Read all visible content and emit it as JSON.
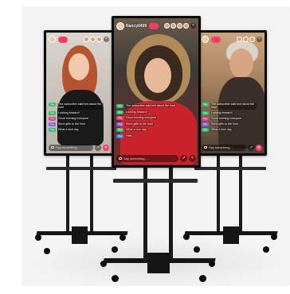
{
  "product": {
    "units": [
      {
        "id": "left",
        "streamer_name": "",
        "chat": [
          {
            "tag": "Tag",
            "text": "The subscriber said text about the host"
          },
          {
            "tag": "Tag",
            "text": "Looking forward!"
          },
          {
            "tag": "Tag",
            "text": "Good evening everyone"
          },
          {
            "tag": "Tag",
            "text": "Send gifts to the host"
          },
          {
            "tag": "Tag",
            "text": "What a nice day"
          },
          {
            "tag": "Tag",
            "text": "Hello"
          }
        ],
        "input_placeholder": "Say something..."
      },
      {
        "id": "center",
        "streamer_name": "Nancy0409",
        "chat": [
          {
            "tag": "Tag",
            "text": "The subscriber said text about the host"
          },
          {
            "tag": "Tag",
            "text": "Looking forward!"
          },
          {
            "tag": "Tag",
            "text": "Good evening everyone"
          },
          {
            "tag": "Tag",
            "text": "Send gifts to the host"
          },
          {
            "tag": "Tag",
            "text": "What a nice day"
          },
          {
            "tag": "Tag",
            "text": "Hello"
          }
        ],
        "input_placeholder": "Say something..."
      },
      {
        "id": "right",
        "streamer_name": "",
        "chat": [
          {
            "tag": "Tag",
            "text": "The subscriber said text about the host"
          },
          {
            "tag": "Tag",
            "text": "Looking forward!"
          },
          {
            "tag": "Tag",
            "text": "Good evening everyone"
          },
          {
            "tag": "Tag",
            "text": "Send gifts to the host"
          },
          {
            "tag": "Tag",
            "text": "What a nice day"
          },
          {
            "tag": "Tag",
            "text": "Hello"
          }
        ],
        "input_placeholder": "Say something..."
      }
    ],
    "colors": {
      "stand": "#1b1b1b",
      "follow_accent": "#ff3b6b",
      "tag_colors": [
        "#2fbf71",
        "#2fbf71",
        "#e0457b",
        "#8a5cf6",
        "#2fbf71",
        "#3b82f6"
      ]
    },
    "icons": [
      "message-icon",
      "share-icon",
      "gift-icon",
      "close-icon"
    ]
  }
}
